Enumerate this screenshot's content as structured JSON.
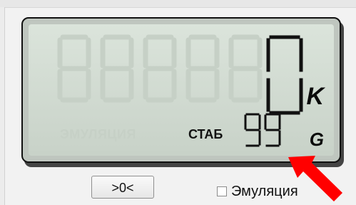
{
  "window": {
    "title": ""
  },
  "lcd": {
    "emulation_ghost_text": "ЭМУЛЯЦИЯ",
    "stab_label": "СТАБ",
    "main_value": "0",
    "stab_value": "99",
    "unit_main": "K",
    "unit_stab": "G",
    "background_color": "#d3dcd3",
    "inactive_segment_color": "#c7d2c7",
    "active_segment_color": "#111111"
  },
  "controls": {
    "zero_button_label": ">0<",
    "emulation_checkbox_label": "Эмуляция",
    "emulation_checked": false
  },
  "annotation": {
    "arrow_color": "#ff0000",
    "arrow_icon": "red-arrow-icon"
  }
}
